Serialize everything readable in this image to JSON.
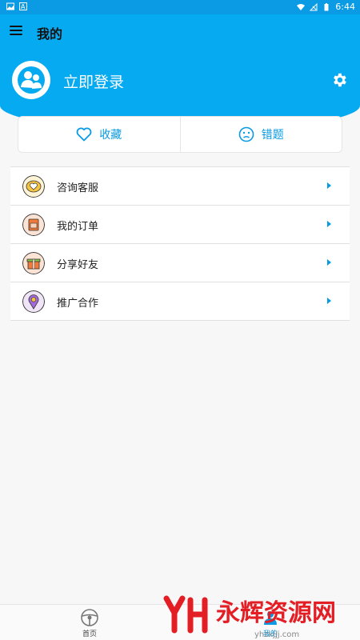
{
  "status_bar": {
    "time": "6:44"
  },
  "toolbar": {
    "title": "我的",
    "menu_icon": "hamburger-menu-icon"
  },
  "profile": {
    "login_label": "立即登录",
    "avatar_icon": "user-group-avatar-icon",
    "settings_icon": "gear-icon"
  },
  "tabs": [
    {
      "label": "收藏",
      "icon": "heart-outline-icon"
    },
    {
      "label": "错题",
      "icon": "neutral-face-icon"
    }
  ],
  "menu": [
    {
      "label": "咨询客服",
      "icon": "heart-chat-icon",
      "icon_color": "#f5c542"
    },
    {
      "label": "我的订单",
      "icon": "envelope-order-icon",
      "icon_color": "#f07a3a"
    },
    {
      "label": "分享好友",
      "icon": "gift-icon",
      "icon_color": "#8bc34a"
    },
    {
      "label": "推广合作",
      "icon": "location-pin-icon",
      "icon_color": "#a56ad9"
    }
  ],
  "bottom_nav": [
    {
      "label": "首页",
      "icon": "steering-wheel-icon",
      "active": false
    },
    {
      "label": "我的",
      "icon": "profile-icon",
      "active": true
    }
  ],
  "watermark": {
    "text": "永辉资源网",
    "url": "yhzkjjj.com"
  },
  "colors": {
    "primary": "#06aaf0",
    "accent": "#0a9be4"
  }
}
